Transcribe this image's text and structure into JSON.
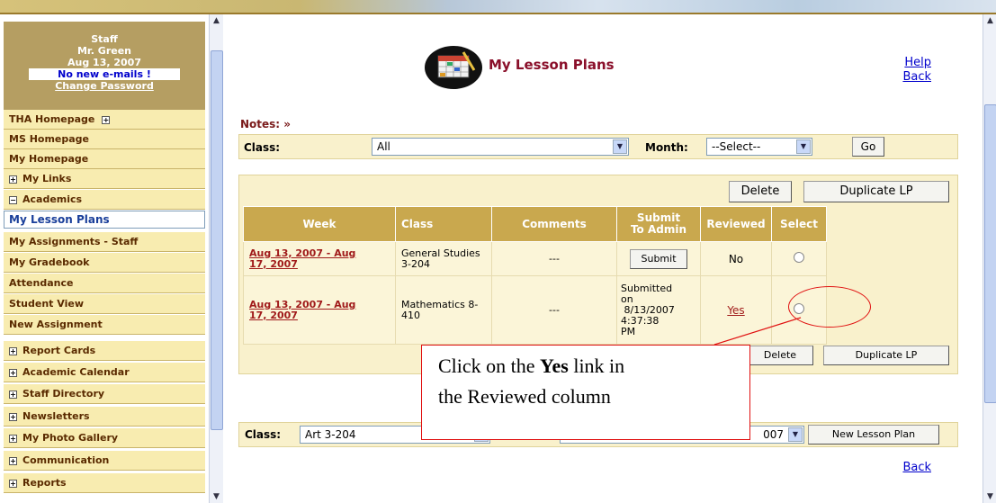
{
  "user": {
    "role": "Staff",
    "name": "Mr. Green",
    "date": "Aug 13, 2007",
    "email_status": "No new e-mails !",
    "change_password": "Change Password"
  },
  "nav": [
    {
      "label": "THA Homepage",
      "toggle": "after"
    },
    {
      "label": "MS Homepage"
    },
    {
      "label": "My Homepage"
    },
    {
      "label": "My Links",
      "toggle": "before"
    },
    {
      "label": "Academics",
      "toggle": "minus"
    },
    {
      "label": "My Lesson Plans",
      "selected": true
    },
    {
      "label": "My Assignments - Staff"
    },
    {
      "label": "My Gradebook"
    },
    {
      "label": "Attendance"
    },
    {
      "label": "Student View"
    },
    {
      "label": "New Assignment"
    },
    {
      "label": "Report Cards",
      "toggle": "before"
    },
    {
      "label": "Academic Calendar",
      "toggle": "before"
    },
    {
      "label": "Staff Directory",
      "toggle": "before"
    },
    {
      "label": "Newsletters",
      "toggle": "before"
    },
    {
      "label": "My Photo Gallery",
      "toggle": "before"
    },
    {
      "label": "Communication",
      "toggle": "before"
    },
    {
      "label": "Reports",
      "toggle": "before"
    }
  ],
  "page": {
    "title": "My Lesson Plans",
    "help": "Help",
    "back_top": "Back",
    "back_bottom": "Back",
    "notes": "Notes: »"
  },
  "filter": {
    "class_label": "Class:",
    "class_value": "All",
    "month_label": "Month:",
    "month_value": "--Select--",
    "go": "Go"
  },
  "toolbar": {
    "delete": "Delete",
    "duplicate": "Duplicate LP"
  },
  "table": {
    "headers": {
      "week": "Week",
      "class": "Class",
      "comments": "Comments",
      "submit_line1": "Submit",
      "submit_line2": "To Admin",
      "reviewed": "Reviewed",
      "select": "Select"
    },
    "rows": [
      {
        "week_line1": "Aug 13, 2007 - Aug",
        "week_line2": "17, 2007",
        "class_line1": "General Studies",
        "class_line2": "3-204",
        "comments": "---",
        "submit_button": "Submit",
        "reviewed": "No"
      },
      {
        "week_line1": "Aug 13, 2007 - Aug",
        "week_line2": "17, 2007",
        "class_line1": "Mathematics 8-",
        "class_line2": "410",
        "comments": "---",
        "submitted": [
          "Submitted",
          "on",
          "8/13/2007",
          "4:37:38",
          "PM"
        ],
        "reviewed": "Yes"
      }
    ]
  },
  "bottom": {
    "class_label": "Class:",
    "class_value": "Art 3-204",
    "week_value_visible": "007",
    "new_lesson_plan": "New Lesson Plan"
  },
  "callout": {
    "line1_pre": "Click on the ",
    "line1_bold": "Yes",
    "line1_post": " link in",
    "line2": "the Reviewed column"
  }
}
